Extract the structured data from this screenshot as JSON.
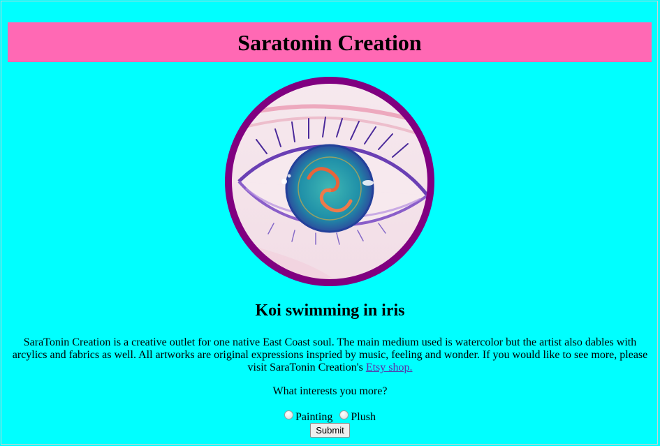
{
  "header": {
    "title": "Saratonin Creation"
  },
  "artwork": {
    "alt": "Koi swimming in iris",
    "caption": "Koi swimming in iris"
  },
  "description": {
    "text": "SaraTonin Creation is a creative outlet for one native East Coast soul. The main medium used is watercolor but the artist also dables with arcylics and fabrics as well. All artworks are original expressions inspried by music, feeling and wonder. If you would like to see more, please visit SaraTonin Creation's ",
    "link_label": "Etsy shop."
  },
  "form": {
    "question": "What interests you more?",
    "options": [
      "Painting",
      "Plush"
    ],
    "submit_label": "Submit"
  },
  "colors": {
    "background": "#00ffff",
    "banner": "#ff69b4",
    "frame_ring": "#800080"
  }
}
